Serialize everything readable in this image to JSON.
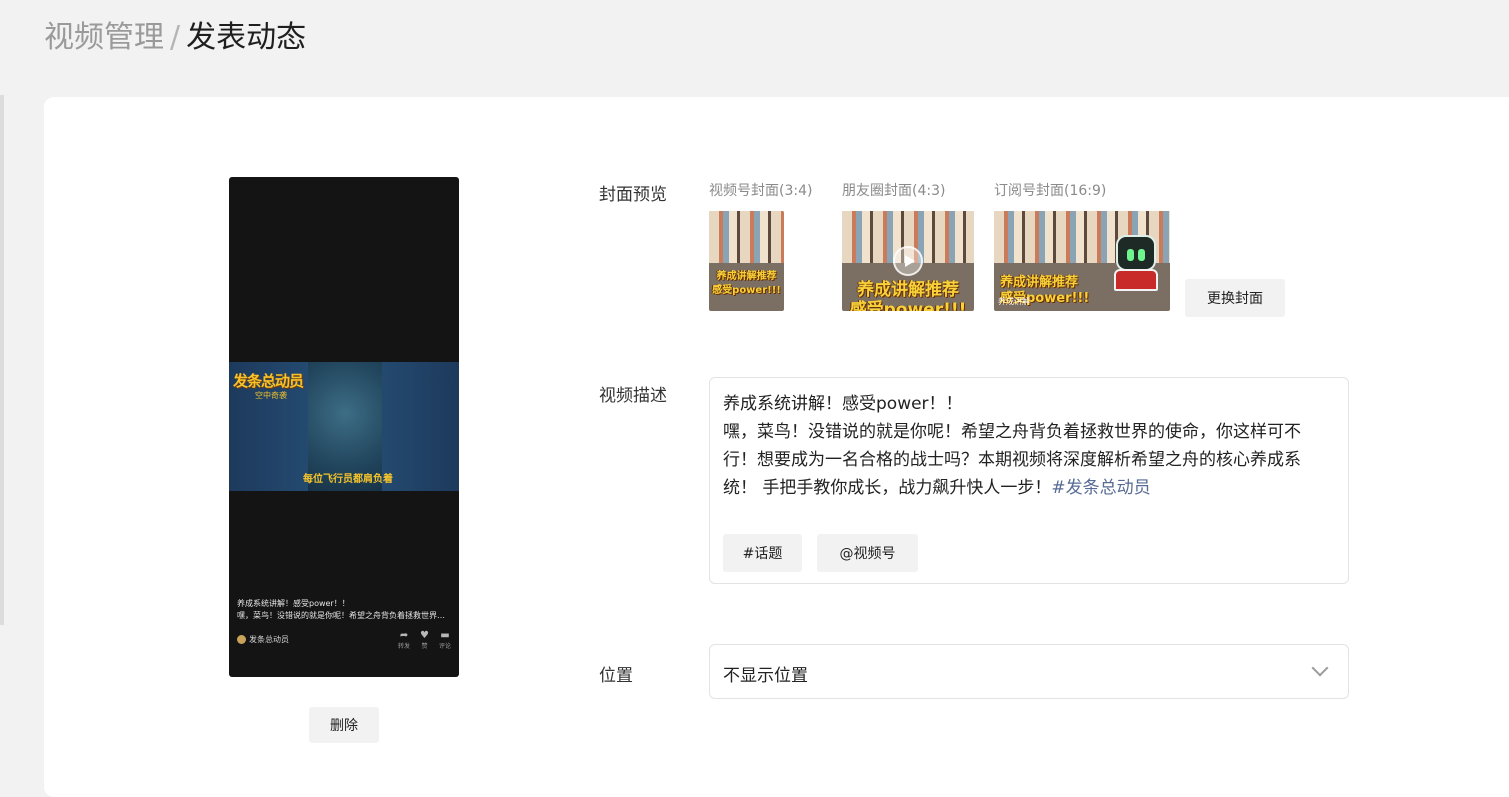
{
  "breadcrumb": {
    "parent": "视频管理",
    "separator": "/",
    "current": "发表动态"
  },
  "preview": {
    "frame_title": "发条总动员",
    "frame_subtitle": "空中奇袭",
    "frame_caption": "每位飞行员都肩负着",
    "caption_line1": "养成系统讲解！感受power！！",
    "caption_line2": "嘿，菜鸟！没错说的就是你呢！希望之舟背负着拯救世界的...",
    "author": "发条总动员",
    "actions": [
      {
        "icon": "share-icon",
        "glyph": "➦",
        "label": "转发"
      },
      {
        "icon": "heart-icon",
        "glyph": "♥",
        "label": "赞"
      },
      {
        "icon": "comment-icon",
        "glyph": "▬",
        "label": "评论"
      }
    ],
    "delete_label": "删除"
  },
  "cover": {
    "label": "封面预览",
    "channels_title": "视频号封面(3:4)",
    "moments_title": "朋友圈封面(4:3)",
    "subscription_title": "订阅号封面(16:9)",
    "channels_text_line1": "养成讲解推荐",
    "channels_text_line2": "感受power!!!",
    "moments_text_line1": "养成讲解推荐",
    "moments_text_line2": "感受power!!!",
    "subscription_text_line1": "养成讲解推荐",
    "subscription_text_line2": "感受power!!!",
    "subscription_footer": "养成讲解",
    "change_label": "更换封面"
  },
  "description": {
    "label": "视频描述",
    "line1": "养成系统讲解！感受power！！",
    "line2": "嘿，菜鸟！没错说的就是你呢！希望之舟背负着拯救世界的使命，你这样可不行！想要成为一名合格的战士吗？本期视频将深度解析希望之舟的核心养成系统！ 手把手教你成长，战力飙升快人一步！",
    "hashtag": "#发条总动员",
    "topic_button": "#话题",
    "mention_button": "@视频号"
  },
  "location": {
    "label": "位置",
    "value": "不显示位置"
  }
}
